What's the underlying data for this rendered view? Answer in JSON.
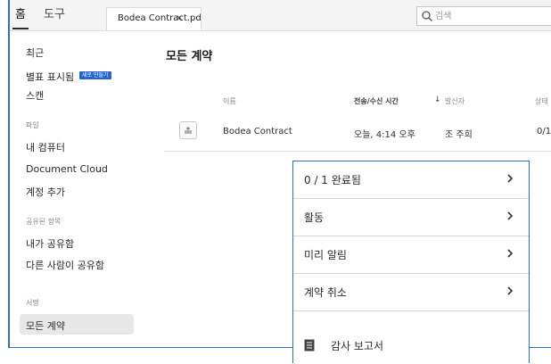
{
  "topbar": {
    "tab_home": "홈",
    "tab_tools": "도구",
    "doc_tab_label": "Bodea Contract.pdf",
    "doc_tab_close": "×",
    "search_placeholder": "검색"
  },
  "sidebar": {
    "recent": "최근",
    "starred": "별표 표시됨",
    "new_badge": "새로 만들기",
    "scan": "스캔",
    "files_header": "파일",
    "my_computer": "내 컴퓨터",
    "document_cloud": "Document Cloud",
    "add_account": "계정 추가",
    "shared_header": "공유된 항목",
    "shared_by_me": "내가 공유함",
    "shared_by_others": "다른 사람이 공유함",
    "sign_header": "서명",
    "all_agreements": "모든 계약"
  },
  "main": {
    "title": "모든 계약",
    "columns": {
      "name": "이름",
      "sent_received": "전송/수신 시간",
      "sort_arrow": "↓",
      "sender": "발신자",
      "status": "상태"
    },
    "row": {
      "name": "Bodea Contract",
      "time": "오늘, 4:14 오후",
      "sender": "조 주희",
      "status": "0/1"
    }
  },
  "popup": {
    "items": [
      {
        "label": "0 / 1 완료됨"
      },
      {
        "label": "활동"
      },
      {
        "label": "미리 알림"
      },
      {
        "label": "계약 취소"
      }
    ],
    "audit_report": "감사 보고서"
  },
  "colors": {
    "accent": "#2c70c9",
    "badge": "#2463d8",
    "selected_bg": "#e8e8e8"
  }
}
